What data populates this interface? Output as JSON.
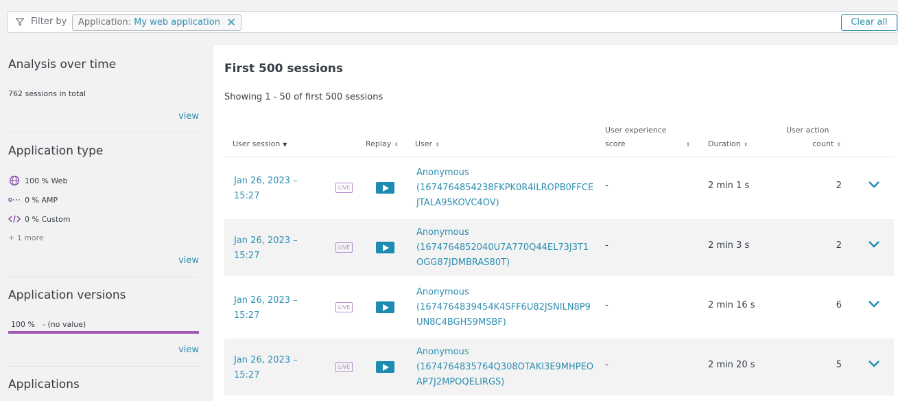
{
  "filter": {
    "label": "Filter by",
    "chip_key": "Application:",
    "chip_value": "My web application",
    "chip_close": "✕",
    "clear_all": "Clear all"
  },
  "left": {
    "analysis": {
      "title": "Analysis over time",
      "total": "762 sessions in total",
      "view": "view"
    },
    "app_type": {
      "title": "Application type",
      "items": [
        {
          "label": "100 % Web",
          "icon": "globe-icon"
        },
        {
          "label": "0 % AMP",
          "icon": "amp-icon"
        },
        {
          "label": "0 % Custom",
          "icon": "code-icon"
        }
      ],
      "more": "+ 1 more",
      "view": "view"
    },
    "versions": {
      "title": "Application versions",
      "percent": "100 %",
      "value": "- (no value)",
      "view": "view"
    },
    "applications": {
      "title": "Applications"
    }
  },
  "main": {
    "title": "First 500 sessions",
    "showing": "Showing 1 - 50 of first 500 sessions",
    "columns": {
      "session": "User session",
      "replay": "Replay",
      "user": "User",
      "ux_line1": "User experience",
      "ux_line2": "score",
      "duration": "Duration",
      "count_line1": "User action",
      "count_line2": "count"
    },
    "live_badge": "LIVE",
    "rows": [
      {
        "date": "Jan 26, 2023 –",
        "time": "15:27",
        "user": "Anonymous",
        "id1": "(1674764854238FKPK0R4ILROPB0FFCE",
        "id2": "JTALA95KOVC4OV)",
        "ux": "-",
        "duration": "2 min 1 s",
        "count": "2"
      },
      {
        "date": "Jan 26, 2023 –",
        "time": "15:27",
        "user": "Anonymous",
        "id1": "(1674764852040U7A770Q44EL73J3T1",
        "id2": "OGG87JDMBRAS80T)",
        "ux": "-",
        "duration": "2 min 3 s",
        "count": "2"
      },
      {
        "date": "Jan 26, 2023 –",
        "time": "15:27",
        "user": "Anonymous",
        "id1": "(1674764839454K4SFF6U82JSNILN8P9",
        "id2": "UN8C4BGH59MSBF)",
        "ux": "-",
        "duration": "2 min 16 s",
        "count": "6"
      },
      {
        "date": "Jan 26, 2023 –",
        "time": "15:27",
        "user": "Anonymous",
        "id1": "(1674764835764Q308OTAKI3E9MHPEO",
        "id2": "AP7J2MPOQELIRGS)",
        "ux": "-",
        "duration": "2 min 20 s",
        "count": "5"
      }
    ]
  }
}
